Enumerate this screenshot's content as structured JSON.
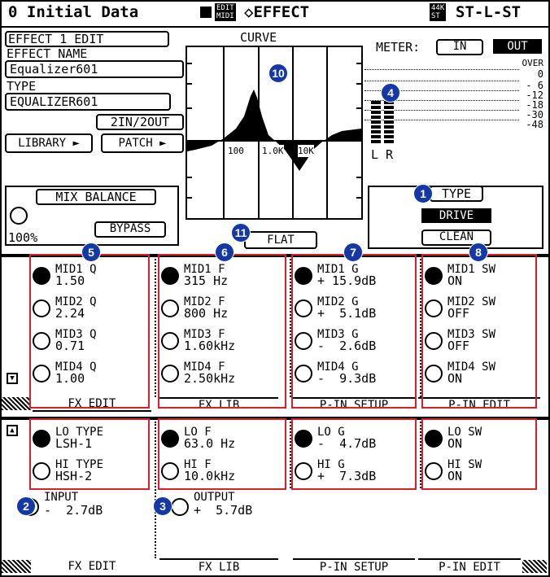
{
  "header": {
    "scene": "0 Initial Data",
    "edit_midi": "EDIT\nMIDI",
    "screen": "◇EFFECT",
    "rate": "44K\nST",
    "config": "ST-L-ST"
  },
  "effect_edit": {
    "title": "EFFECT 1 EDIT",
    "name_label": "EFFECT NAME",
    "name_value": "Equalizer601",
    "type_label": "TYPE",
    "type_value": "EQUALIZER601",
    "io": "2IN/2OUT",
    "library_btn": "LIBRARY",
    "patch_btn": "PATCH"
  },
  "curve": {
    "title": "CURVE",
    "freq_labels": [
      "100",
      "1.0K",
      "10K"
    ],
    "flat_btn": "FLAT"
  },
  "meter": {
    "label": "METER:",
    "in_btn": "IN",
    "out_btn": "OUT",
    "scale": [
      "OVER",
      "0",
      "- 6",
      "-12",
      "-18",
      "-30",
      "-48"
    ],
    "ch_l": "L",
    "ch_r": "R"
  },
  "mix_balance": {
    "title": "MIX BALANCE",
    "value": "100%",
    "bypass_btn": "BYPASS"
  },
  "type_panel": {
    "title": "TYPE",
    "drive_btn": "DRIVE",
    "clean_btn": "CLEAN"
  },
  "col1": [
    {
      "name": "MID1",
      "type": "Q",
      "value": "1.50"
    },
    {
      "name": "MID2",
      "type": "Q",
      "value": "2.24"
    },
    {
      "name": "MID3",
      "type": "Q",
      "value": "0.71"
    },
    {
      "name": "MID4",
      "type": "Q",
      "value": "1.00"
    }
  ],
  "col2": [
    {
      "name": "MID1",
      "type": "F",
      "value": "315 Hz"
    },
    {
      "name": "MID2",
      "type": "F",
      "value": "800 Hz"
    },
    {
      "name": "MID3",
      "type": "F",
      "value": "1.60kHz"
    },
    {
      "name": "MID4",
      "type": "F",
      "value": "2.50kHz"
    }
  ],
  "col3": [
    {
      "name": "MID1",
      "type": "G",
      "value": "+ 15.9dB"
    },
    {
      "name": "MID2",
      "type": "G",
      "value": "+  5.1dB"
    },
    {
      "name": "MID3",
      "type": "G",
      "value": "-  2.6dB"
    },
    {
      "name": "MID4",
      "type": "G",
      "value": "-  9.3dB"
    }
  ],
  "col4": [
    {
      "name": "MID1",
      "type": "SW",
      "value": "ON"
    },
    {
      "name": "MID2",
      "type": "SW",
      "value": "OFF"
    },
    {
      "name": "MID3",
      "type": "SW",
      "value": "OFF"
    },
    {
      "name": "MID4",
      "type": "SW",
      "value": "ON"
    }
  ],
  "tabs_upper": [
    "FX EDIT",
    "FX LIB",
    "P-IN SETUP",
    "P-IN EDIT"
  ],
  "lower": {
    "c1": [
      {
        "name": "LO",
        "type": "TYPE",
        "value": "LSH-1"
      },
      {
        "name": "HI",
        "type": "TYPE",
        "value": "HSH-2"
      }
    ],
    "c2": [
      {
        "name": "LO",
        "type": "F",
        "value": "63.0 Hz"
      },
      {
        "name": "HI",
        "type": "F",
        "value": "10.0kHz"
      }
    ],
    "c3": [
      {
        "name": "LO",
        "type": "G",
        "value": "-  4.7dB"
      },
      {
        "name": "HI",
        "type": "G",
        "value": "+  7.3dB"
      }
    ],
    "c4": [
      {
        "name": "LO",
        "type": "SW",
        "value": "ON"
      },
      {
        "name": "HI",
        "type": "SW",
        "value": "ON"
      }
    ],
    "input_label": "INPUT",
    "input_value": "-  2.7dB",
    "output_label": "OUTPUT",
    "output_value": "+  5.7dB"
  },
  "tabs_lower": [
    "FX EDIT",
    "FX LIB",
    "P-IN SETUP",
    "P-IN EDIT"
  ],
  "badges": [
    "1",
    "2",
    "3",
    "4",
    "5",
    "6",
    "7",
    "8",
    "10",
    "11"
  ],
  "colors": {
    "callout_badge": "#1438a8",
    "callout_box": "#d8202a"
  }
}
